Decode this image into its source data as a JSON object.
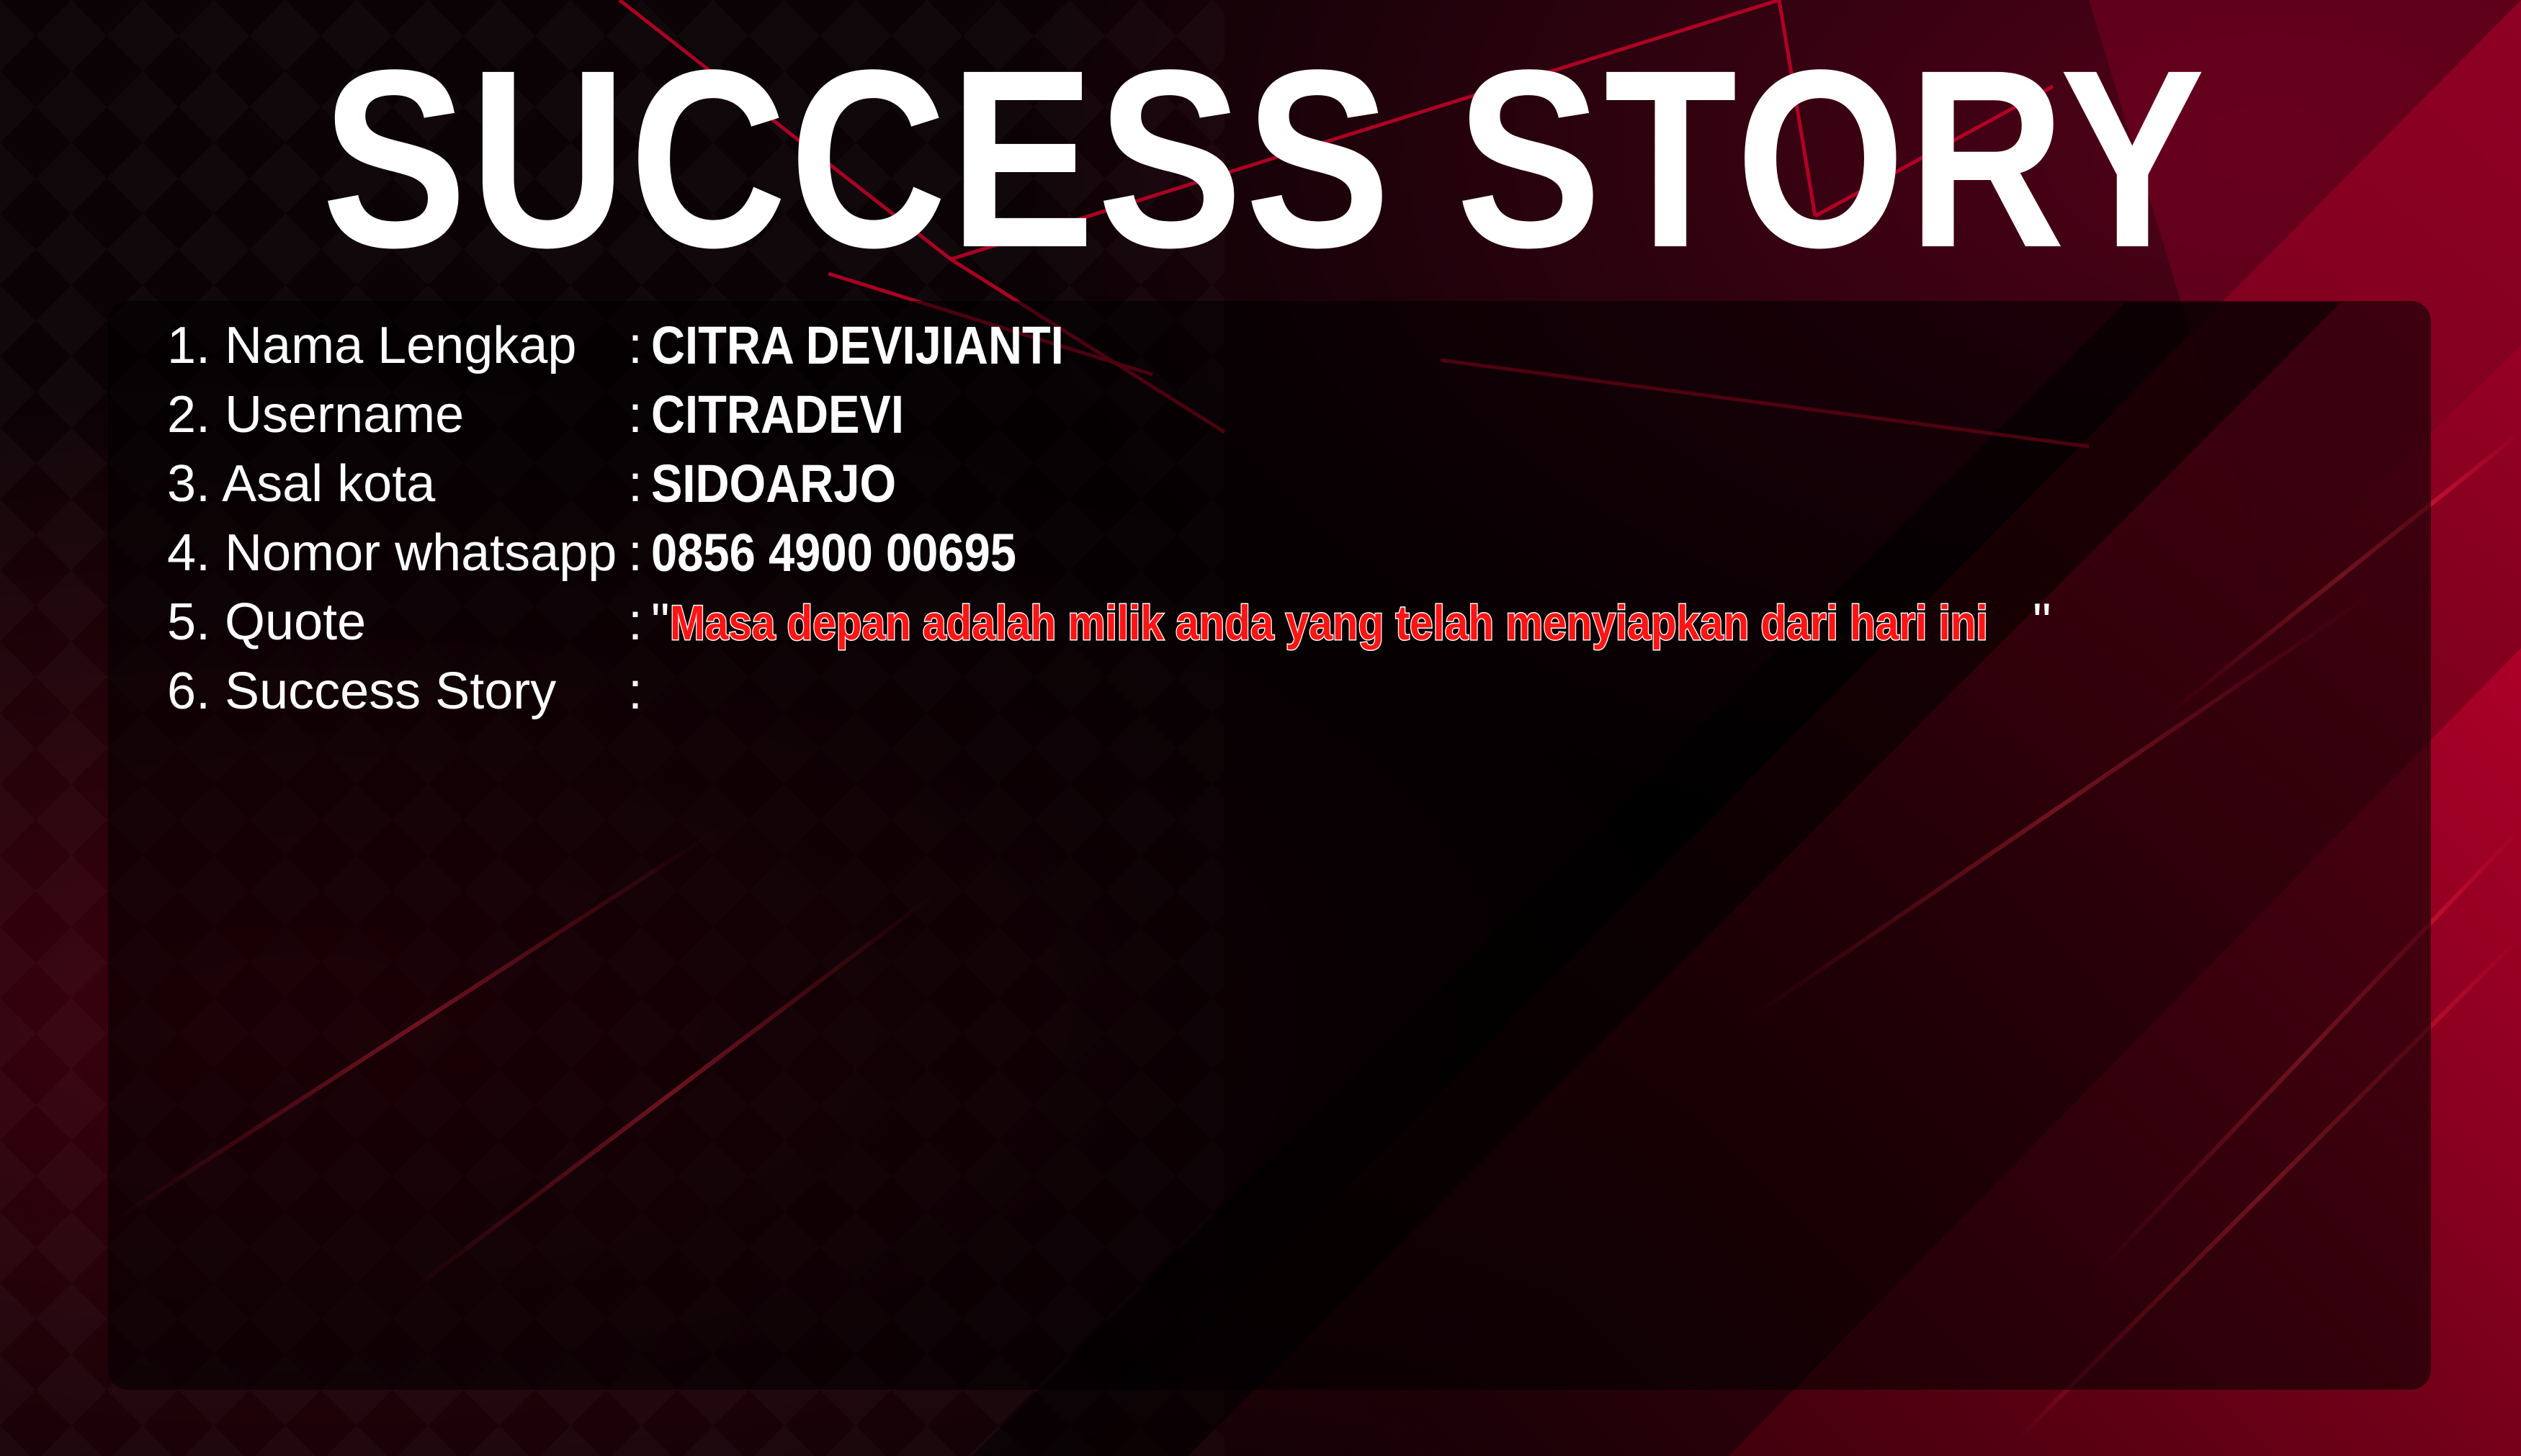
{
  "title": "SUCCESS STORY",
  "fields": [
    {
      "label": "1. Nama Lengkap",
      "separator": ":",
      "value": "CITRA DEVIJIANTI"
    },
    {
      "label": "2. Username",
      "separator": ":",
      "value": "CITRADEVI"
    },
    {
      "label": "3. Asal kota",
      "separator": ":",
      "value": "SIDOARJO"
    },
    {
      "label": "4. Nomor whatsapp",
      "separator": ":",
      "value": "0856 4900 00695"
    },
    {
      "label": "5. Quote",
      "separator": ":",
      "quote_open": "\"",
      "value": "Masa depan adalah milik anda yang telah menyiapkan dari hari ini",
      "quote_close": " \""
    },
    {
      "label": "6. Success Story",
      "separator": ":",
      "value": ""
    }
  ],
  "colors": {
    "background": "#0a0205",
    "accent_red": "#c4002a",
    "quote_red": "#ff1414",
    "text": "#ffffff"
  }
}
